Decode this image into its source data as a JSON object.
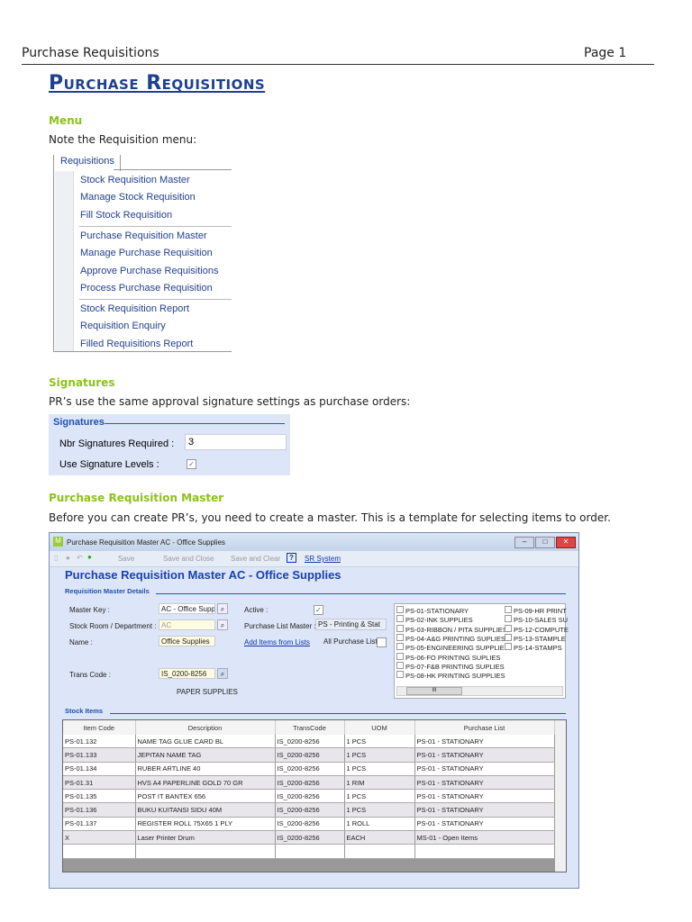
{
  "header": {
    "doc_title": "Purchase Requisitions",
    "page": "Page 1"
  },
  "title": "Purchase Requisitions",
  "menu_section": {
    "heading": "Menu",
    "text": "Note the Requisition menu:",
    "tab": "Requisitions",
    "groups": [
      [
        "Stock Requisition Master",
        "Manage Stock Requisition",
        "Fill Stock Requisition"
      ],
      [
        "Purchase Requisition Master",
        "Manage Purchase Requisition",
        "Approve Purchase Requisitions",
        "Process Purchase Requisition"
      ],
      [
        "Stock Requisition Report",
        "Requisition Enquiry",
        "Filled Requisitions Report"
      ]
    ]
  },
  "signatures": {
    "heading": "Signatures",
    "text": "PR’s use the same approval signature settings as purchase orders:",
    "panel_title": "Signatures",
    "nbr_label": "Nbr Signatures Required :",
    "nbr_value": "3",
    "levels_label": "Use Signature Levels :",
    "levels_checked": true
  },
  "prm": {
    "heading": "Purchase Requisition Master",
    "text": "Before you can create PR’s, you need to create a master. This is a template for selecting items to order."
  },
  "window": {
    "title": "Purchase Requisition Master AC - Office Supplies",
    "toolbar": {
      "save": "Save",
      "save_close": "Save and Close",
      "save_clear": "Save and Clear",
      "help": "?",
      "link": "SR System"
    },
    "heading": "Purchase Requisition Master AC - Office Supplies",
    "details_label": "Requisition Master Details",
    "master_key_label": "Master Key :",
    "master_key": "AC - Office Supplies",
    "stock_room_label": "Stock Room / Department :",
    "stock_room": "AC",
    "name_label": "Name :",
    "name": "Office Supplies",
    "trans_code_label": "Trans Code :",
    "trans_code": "IS_0200-8256",
    "trans_desc": "PAPER SUPPLIES",
    "active_label": "Active :",
    "active": true,
    "plm_label": "Purchase List Master :",
    "plm_value": "PS - Printing & Stat",
    "add_items": "Add Items from Lists",
    "all_lists_label": "All Purchase Lists",
    "lists_col1": [
      "PS-01-STATIONARY",
      "PS-02-INK SUPPLIES",
      "PS-03-RIBBON / PITA SUPPLIES",
      "PS-04-A&G PRINTING SUPLIES",
      "PS-05-ENGINEERING SUPPLIES",
      "PS-06-FO PRINTING SUPLIES",
      "PS-07-F&B PRINTING SUPLIES",
      "PS-08-HK PRINTING SUPPLIES"
    ],
    "lists_col2": [
      "PS-09-HR PRINT",
      "PS-10-SALES SU",
      "PS-12-COMPUTE",
      "PS-13-STAMPLE",
      "PS-14-STAMPS"
    ],
    "scroll_mark": "III",
    "stock_label": "Stock Items",
    "columns": [
      "Item Code",
      "Description",
      "TransCode",
      "UOM",
      "Purchase List"
    ],
    "rows": [
      [
        "PS-01.132",
        "NAME TAG GLUE CARD BL",
        "IS_0200-8256",
        "1 PCS",
        "PS-01 - STATIONARY"
      ],
      [
        "PS-01.133",
        "JEPITAN NAME TAG",
        "IS_0200-8256",
        "1 PCS",
        "PS-01 - STATIONARY"
      ],
      [
        "PS-01.134",
        "RUBER ARTLINE 40",
        "IS_0200-8256",
        "1 PCS",
        "PS-01 - STATIONARY"
      ],
      [
        "PS-01.31",
        "HVS A4 PAPERLINE GOLD 70 GR",
        "IS_0200-8256",
        "1 RIM",
        "PS-01 - STATIONARY"
      ],
      [
        "PS-01.135",
        "POST IT BANTEX 656",
        "IS_0200-8256",
        "1 PCS",
        "PS-01 - STATIONARY"
      ],
      [
        "PS-01.136",
        "BUKU KUITANSI SIDU 40M",
        "IS_0200-8256",
        "1 PCS",
        "PS-01 - STATIONARY"
      ],
      [
        "PS-01.137",
        "REGISTER ROLL 75X65 1 PLY",
        "IS_0200-8256",
        "1 ROLL",
        "PS-01 - STATIONARY"
      ],
      [
        "X",
        "Laser Printer Drum",
        "IS_0200-8256",
        "EACH",
        "MS-01 - Open Items"
      ],
      [
        "",
        "",
        "",
        "",
        ""
      ]
    ]
  }
}
